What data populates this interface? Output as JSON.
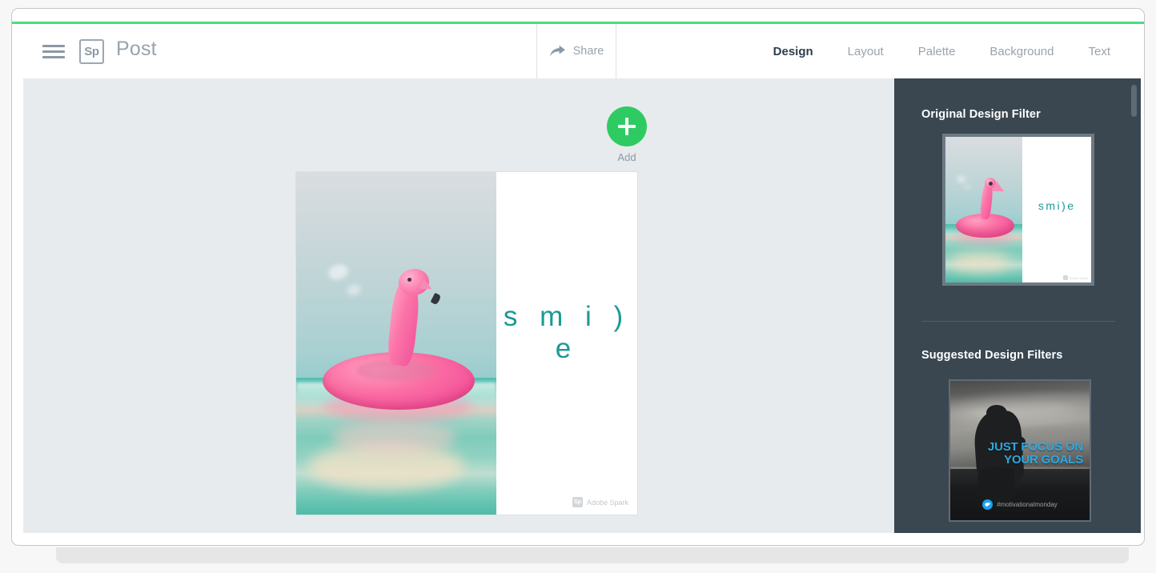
{
  "app": {
    "name": "Adobe Spark Post Editor",
    "accent_green": "#4ddb82",
    "sidebar_bg": "#3a4751",
    "canvas_bg": "#e8ebed"
  },
  "topbar": {
    "menu_icon": "hamburger-menu-icon",
    "logo_text": "Sp",
    "title": "Post",
    "share_label": "Share",
    "share_icon": "share-arrow-icon",
    "tabs": [
      {
        "label": "Design",
        "active": true
      },
      {
        "label": "Layout",
        "active": false
      },
      {
        "label": "Palette",
        "active": false
      },
      {
        "label": "Background",
        "active": false
      },
      {
        "label": "Text",
        "active": false
      }
    ]
  },
  "canvas": {
    "add_button_label": "Add",
    "add_button_icon": "plus-icon",
    "design_text": "s m i ) e",
    "design_text_color": "#1a9a94",
    "watermark_logo": "Sp",
    "watermark_text": "Adobe Spark",
    "photo_description": "pink inflatable flamingo float on turquoise water"
  },
  "sidebar": {
    "original_heading": "Original Design Filter",
    "suggested_heading": "Suggested Design Filters",
    "original_thumbnail": {
      "name": "original-design-thumbnail",
      "text": "smi)e",
      "watermark": "Adobe Spark",
      "selected": true
    },
    "suggested_thumbnails": [
      {
        "name": "suggested-design-thumbnail-goals",
        "headline": "JUST FOCUS ON YOUR GOALS",
        "headline_color": "#2fa8e0",
        "hashtag": "#motivationalmonday",
        "social_icon": "twitter-icon"
      }
    ],
    "scrollbar": "sidebar-scrollbar"
  }
}
